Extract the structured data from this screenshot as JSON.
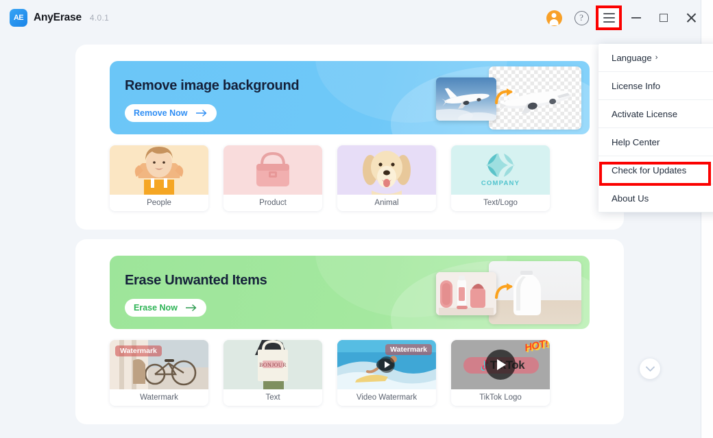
{
  "titlebar": {
    "logo_text": "AE",
    "app_name": "AnyErase",
    "version": "4.0.1",
    "icons": {
      "avatar": "avatar-icon",
      "help": "?",
      "menu": "hamburger-menu-icon",
      "minimize": "minimize-icon",
      "maximize": "maximize-icon",
      "close": "close-icon"
    }
  },
  "dropdown": {
    "items": [
      {
        "label": "Language",
        "chevron": "›",
        "highlighted": false
      },
      {
        "label": "License Info",
        "chevron": "",
        "highlighted": false
      },
      {
        "label": "Activate License",
        "chevron": "",
        "highlighted": false
      },
      {
        "label": "Help Center",
        "chevron": "",
        "highlighted": false
      },
      {
        "label": "Check for Updates",
        "chevron": "",
        "highlighted": true
      },
      {
        "label": "About Us",
        "chevron": "",
        "highlighted": false
      }
    ]
  },
  "sections": [
    {
      "id": "remove-background",
      "hero_title": "Remove image background",
      "hero_button": "Remove Now",
      "hero_color": "#6bc6f7",
      "button_text_color": "#2f8ef4",
      "tiles": [
        {
          "label": "People",
          "bg": "#fbe6c3"
        },
        {
          "label": "Product",
          "bg": "#f9dcdc"
        },
        {
          "label": "Animal",
          "bg": "#e7ddf7"
        },
        {
          "label": "Text/Logo",
          "bg": "#d6f2f1",
          "logo_text": "COMPANY"
        }
      ]
    },
    {
      "id": "erase-items",
      "hero_title": "Erase Unwanted Items",
      "hero_button": "Erase Now",
      "hero_color": "#9de59a",
      "button_text_color": "#2fb457",
      "tiles": [
        {
          "label": "Watermark",
          "bg": "#e9ddd0",
          "badge": "Watermark"
        },
        {
          "label": "Text",
          "bg": "#dde8e1",
          "badge": "BONJOUR"
        },
        {
          "label": "Video Watermark",
          "bg": "#4fb2dd",
          "badge": "Watermark",
          "has_play": true
        },
        {
          "label": "TikTok Logo",
          "bg": "#a8a8a8",
          "badge": "TikTok",
          "has_play": true,
          "hot": "HOT!"
        }
      ]
    }
  ],
  "colors": {
    "page_bg": "#f2f5f9",
    "highlight_red": "#fb0100",
    "accent_blue": "#2f8ef4",
    "accent_green": "#2fb457",
    "avatar_orange": "#f8a028"
  }
}
